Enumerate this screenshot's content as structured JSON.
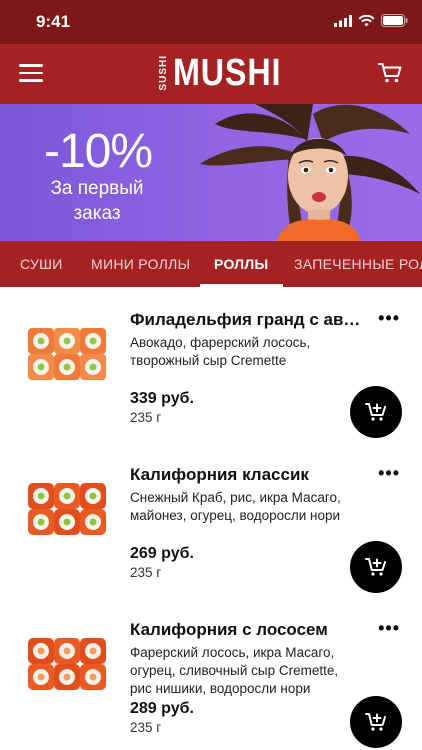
{
  "status_bar": {
    "time": "9:41"
  },
  "header": {
    "logo_small": "SUSHI",
    "logo_big": "MUSHI"
  },
  "banner": {
    "discount": "-10%",
    "subtitle_line1": "За первый",
    "subtitle_line2": "заказ"
  },
  "tabs": [
    {
      "label": "СУШИ"
    },
    {
      "label": "МИНИ РОЛЛЫ"
    },
    {
      "label": "РОЛЛЫ",
      "active": true
    },
    {
      "label": "ЗАПЕЧЕННЫЕ РОЛЛЫ"
    }
  ],
  "products": [
    {
      "name": "Филадельфия гранд с авокадо",
      "description": "Авокадо, фарерский лосось, творожный сыр Cremette",
      "price": "339 руб.",
      "weight": "235 г"
    },
    {
      "name": "Калифорния классик",
      "description": "Снежный Краб, рис, икра Масаго, майонез, огурец, водоросли нори",
      "price": "269 руб.",
      "weight": "235 г"
    },
    {
      "name": "Калифорния с лососем",
      "description": "Фарерский лосось, икра Масаго, огурец, сливочный сыр Cremette, рис нишики, водоросли нори",
      "price": "289 руб.",
      "weight": "235 г"
    }
  ],
  "icons": {
    "menu": "hamburger-icon",
    "cart": "cart-icon",
    "more": "more-dots-icon",
    "add_to_cart": "cart-plus-icon"
  },
  "colors": {
    "brand_red": "#a42222",
    "status_bar": "#7c1818",
    "banner_purple": "#8f63e2"
  }
}
